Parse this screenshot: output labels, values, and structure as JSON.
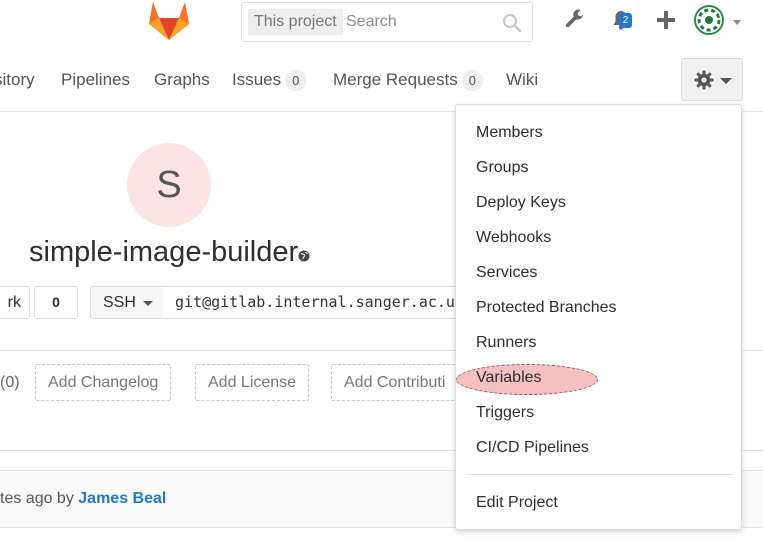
{
  "header": {
    "search_scope": "This project",
    "search_placeholder": "Search",
    "notification_count": "2",
    "colors": {
      "logo_orange": "#e24329",
      "logo_light": "#fca326",
      "badge": "#1f78d1"
    }
  },
  "nav": {
    "items": [
      {
        "label": "sitory"
      },
      {
        "label": "Pipelines"
      },
      {
        "label": "Graphs"
      },
      {
        "label": "Issues",
        "count": "0"
      },
      {
        "label": "Merge Requests",
        "count": "0"
      },
      {
        "label": "Wiki"
      }
    ]
  },
  "project": {
    "avatar_letter": "S",
    "name": "simple-image-builder",
    "fork_label": "rk",
    "fork_count": "0",
    "protocol": "SSH",
    "clone_url": "git@gitlab.internal.sanger.ac.uk:"
  },
  "quick_actions": {
    "count_text": "(0)",
    "buttons": [
      "Add Changelog",
      "Add License",
      "Add Contributi"
    ]
  },
  "commit": {
    "prefix": "tes ago by ",
    "author": "James Beal"
  },
  "settings_menu": {
    "items": [
      "Members",
      "Groups",
      "Deploy Keys",
      "Webhooks",
      "Services",
      "Protected Branches",
      "Runners",
      "Variables",
      "Triggers",
      "CI/CD Pipelines"
    ],
    "footer_item": "Edit Project",
    "highlighted_item": "Variables"
  }
}
